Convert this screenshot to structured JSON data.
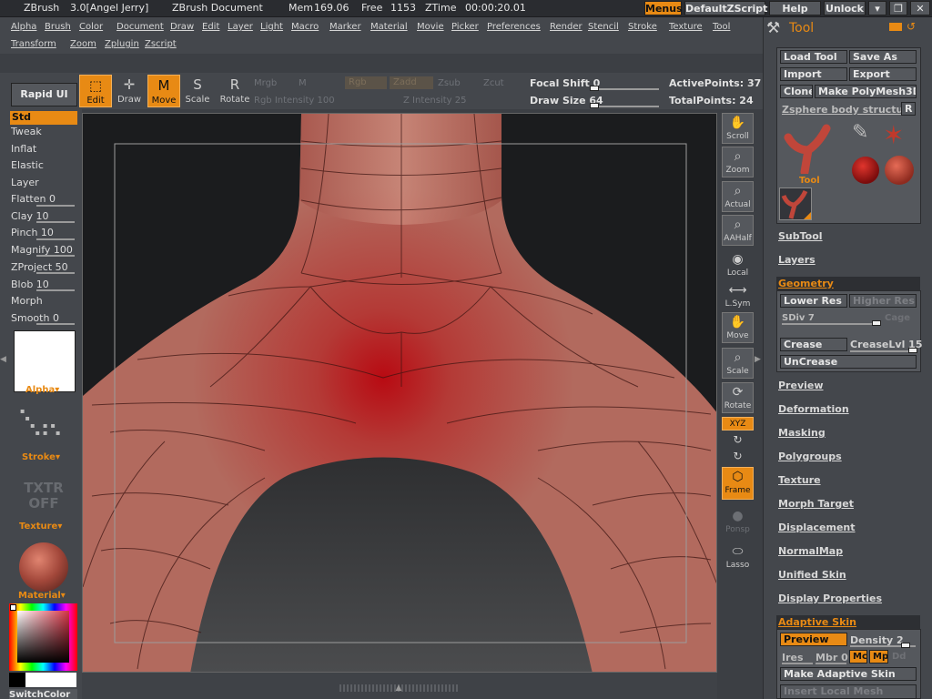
{
  "titlebar": {
    "app": "ZBrush",
    "version": "3.0[Angel Jerry]",
    "document": "ZBrush Document",
    "mem_label": "Mem",
    "mem_value": "169.06",
    "free_label": "Free",
    "free_value": "1153",
    "ztime_label": "ZTime",
    "ztime_value": "00:00:20.01",
    "buttons": {
      "menus": "Menus",
      "script": "DefaultZScript",
      "help": "Help",
      "unlock": "Unlock"
    }
  },
  "menubar": {
    "row1": [
      "Alpha",
      "Brush",
      "Color",
      "Document",
      "Draw",
      "Edit",
      "Layer",
      "Light",
      "Macro",
      "Marker",
      "Material",
      "Movie",
      "Picker",
      "Preferences",
      "Render",
      "Stencil",
      "Stroke",
      "Texture",
      "Tool"
    ],
    "row2": [
      "Transform",
      "Zoom",
      "Zplugin",
      "Zscript"
    ]
  },
  "toolbar": {
    "rapid_ui": "Rapid UI",
    "edit": "Edit",
    "draw": "Draw",
    "move": "Move",
    "scale": "Scale",
    "rotate": "Rotate",
    "mrgb": "Mrgb",
    "m": "M",
    "rgb": "Rgb",
    "zadd": "Zadd",
    "zsub": "Zsub",
    "zcut": "Zcut",
    "rgb_intensity": "Rgb Intensity 100",
    "z_intensity": "Z Intensity 25",
    "focal_shift": "Focal Shift 0",
    "draw_size": "Draw Size 64",
    "active_points": "ActivePoints: 37",
    "total_points": "TotalPoints: 24"
  },
  "leftpanel": {
    "brushes": [
      "Std",
      "Tweak",
      "Inflat",
      "Elastic",
      "Layer",
      "Flatten 0",
      "Clay 10",
      "Pinch 10",
      "Magnify 100",
      "ZProject 50",
      "Blob 10",
      "Morph",
      "Smooth 0"
    ],
    "alpha": "Alpha",
    "stroke": "Stroke",
    "txtr_off": "TXTR OFF",
    "texture": "Texture",
    "material": "Material",
    "switchcolor": "SwitchColor"
  },
  "righttools": {
    "scroll": "Scroll",
    "zoom": "Zoom",
    "actual": "Actual",
    "aahalf": "AAHalf",
    "local": "Local",
    "lsym": "L.Sym",
    "move": "Move",
    "scale": "Scale",
    "rotate": "Rotate",
    "xyz": "XYZ",
    "frame": "Frame",
    "ponsp": "Ponsp",
    "lasso": "Lasso"
  },
  "rightpanel": {
    "title": "Tool",
    "load_tool": "Load Tool",
    "save_as": "Save As",
    "import": "Import",
    "export": "Export",
    "clone": "Clone",
    "make_polymesh": "Make PolyMesh3D",
    "current_tool": "Zsphere body structu",
    "r": "R",
    "tool_label": "Tool",
    "subtool": "SubTool",
    "layers": "Layers",
    "geometry": "Geometry",
    "lower_res": "Lower Res",
    "higher_res": "Higher Res",
    "sdiv": "SDiv 7",
    "cage": "Cage",
    "crease": "Crease",
    "crease_lvl": "CreaseLvl 15",
    "uncrease": "UnCrease",
    "sections": [
      "Preview",
      "Deformation",
      "Masking",
      "Polygroups",
      "Texture",
      "Morph Target",
      "Displacement",
      "NormalMap",
      "Unified Skin",
      "Display Properties"
    ],
    "adaptive_skin": "Adaptive Skin",
    "preview_btn": "Preview",
    "density": "Density 2",
    "ires": "Ires",
    "mbr": "Mbr 0",
    "mc": "Mc",
    "mp": "Mp",
    "dd": "Dd",
    "make_adaptive": "Make Adaptive Skin",
    "insert_local": "Insert Local Mesh"
  },
  "colors": {
    "accent": "#e88a14",
    "panel": "#44474c",
    "mesh": "#b0574c"
  }
}
